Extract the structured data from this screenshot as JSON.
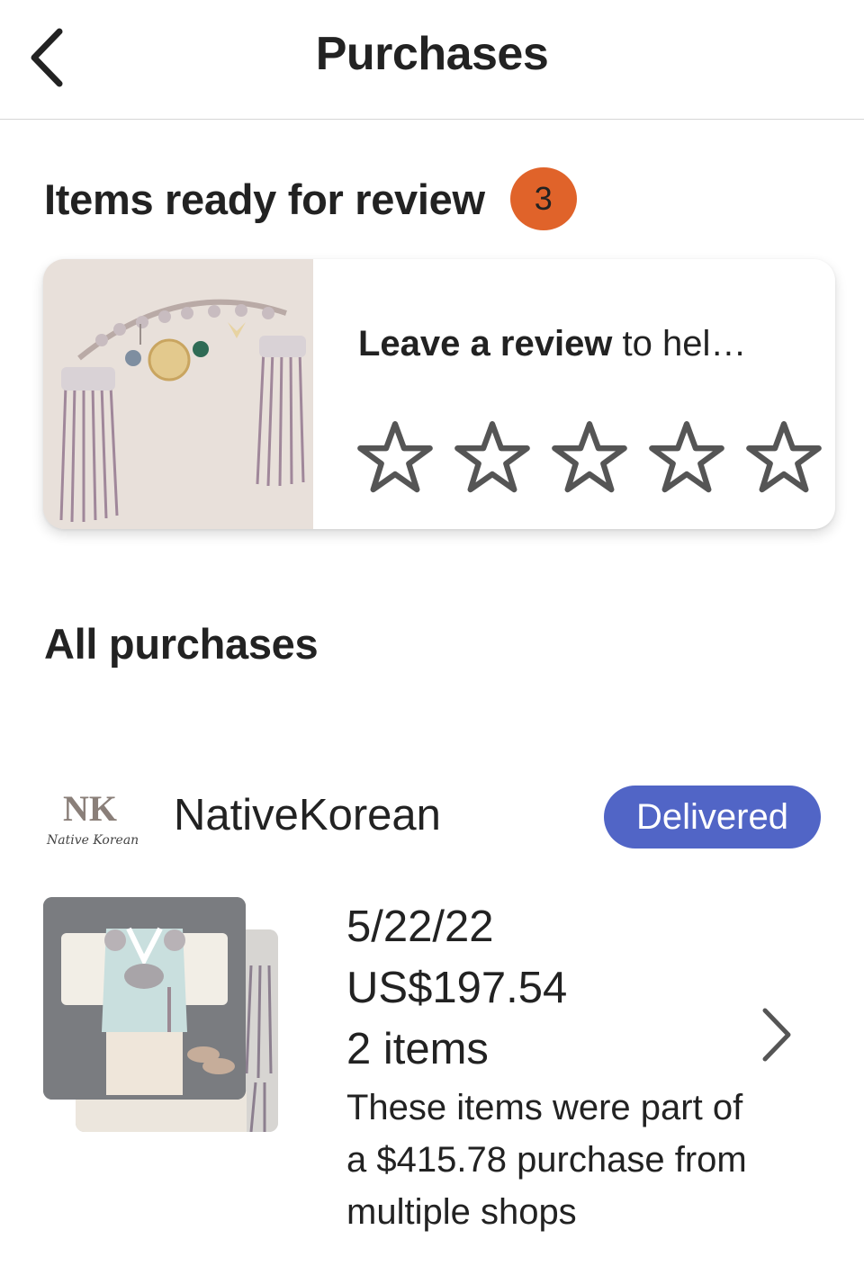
{
  "header": {
    "title": "Purchases",
    "back_icon": "chevron-left-icon"
  },
  "review": {
    "heading": "Items ready for review",
    "count": "3",
    "badge_color": "#e0632a",
    "prompt_bold": "Leave a review",
    "prompt_rest": " to hel…",
    "rating_value": 0,
    "rating_max": 5,
    "star_icon": "star-outline-icon",
    "product_image": "tassel-norigae-ornament"
  },
  "purchases": {
    "heading": "All purchases",
    "orders": [
      {
        "shop_name": "NativeKorean",
        "shop_logo": "nk-shop-logo",
        "logo_letters": "NK",
        "logo_script": "Native Korean",
        "status": "Delivered",
        "status_color": "#5165c6",
        "date": "5/22/22",
        "total": "US$197.54",
        "items": "2 items",
        "note": "These items were part of a $415.78 purchase from multiple shops",
        "product_images": [
          "mint-hanbok-outfit",
          "tassel-ornament"
        ],
        "chevron_icon": "chevron-right-icon"
      }
    ]
  }
}
